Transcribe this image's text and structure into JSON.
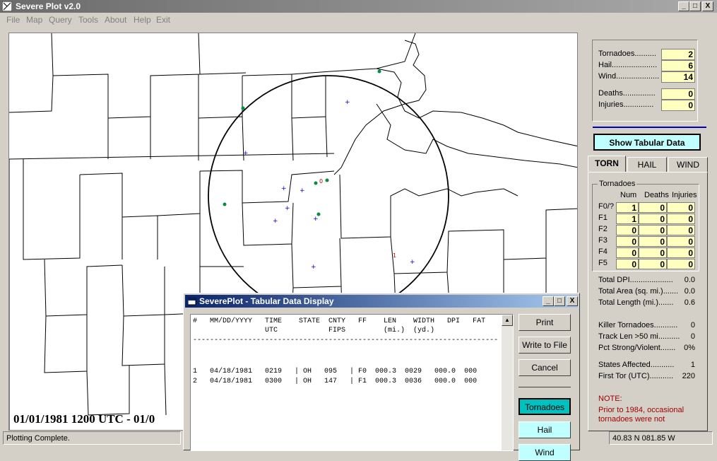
{
  "window": {
    "title": "Severe Plot v2.0",
    "min": "_",
    "max": "□",
    "close": "X"
  },
  "menu": [
    "File",
    "Map",
    "Query",
    "Tools",
    "About",
    "Help",
    "Exit"
  ],
  "map": {
    "date_text": "01/01/1981 1200 UTC - 01/0",
    "labels": [
      "0",
      "1"
    ]
  },
  "status": {
    "left": "Plotting Complete.",
    "coords": "40.83 N  081.85 W",
    "mid": ""
  },
  "summary": {
    "rows": [
      {
        "label": "Tornadoes..........",
        "value": "2"
      },
      {
        "label": "Hail.....................",
        "value": "6"
      },
      {
        "label": "Wind....................",
        "value": "14"
      },
      {
        "label": "Deaths...............",
        "value": "0"
      },
      {
        "label": "Injuries..............",
        "value": "0"
      }
    ]
  },
  "show_tabular": "Show Tabular Data",
  "tabs": [
    "TORN",
    "HAIL",
    "WIND"
  ],
  "torn": {
    "group": "Tornadoes",
    "headers": [
      "Num",
      "Deaths",
      "Injuries"
    ],
    "rows": [
      {
        "label": "F0/?",
        "num": "1",
        "deaths": "0",
        "inj": "0"
      },
      {
        "label": "F1",
        "num": "1",
        "deaths": "0",
        "inj": "0"
      },
      {
        "label": "F2",
        "num": "0",
        "deaths": "0",
        "inj": "0"
      },
      {
        "label": "F3",
        "num": "0",
        "deaths": "0",
        "inj": "0"
      },
      {
        "label": "F4",
        "num": "0",
        "deaths": "0",
        "inj": "0"
      },
      {
        "label": "F5",
        "num": "0",
        "deaths": "0",
        "inj": "0"
      }
    ],
    "stats": [
      {
        "label": "Total DPI....................",
        "value": "0.0"
      },
      {
        "label": "Total Area (sq. mi.).......",
        "value": "0.0"
      },
      {
        "label": "Total Length (mi.).......",
        "value": "0.6"
      },
      {
        "label": "Killer Tornadoes...........",
        "value": "0"
      },
      {
        "label": "Track Len >50 mi..........",
        "value": "0"
      },
      {
        "label": "Pct Strong/Violent.......",
        "value": "0%"
      },
      {
        "label": "States Affected...........",
        "value": "1"
      },
      {
        "label": "First Tor (UTC)...........",
        "value": "220"
      }
    ],
    "note_title": "NOTE:",
    "note_lines": [
      "Prior to 1984, occasional",
      "tornadoes were not"
    ]
  },
  "dialog": {
    "title": "SeverePlot - Tabular Data Display",
    "header1": "#   MM/DD/YYYY   TIME    STATE  CNTY   FF    LEN    WIDTH   DPI   FAT",
    "header2": "                 UTC            FIPS         (mi.)  (yd.)",
    "rule": "------------------------------------------------------------------------------",
    "rows": [
      "1   04/18/1981   0219   | OH   095   | F0  000.3  0029   000.0  000",
      "2   04/18/1981   0300   | OH   147   | F1  000.3  0036   000.0  000"
    ],
    "buttons": [
      "Print",
      "Write to File",
      "Cancel"
    ],
    "type_buttons": [
      "Tornadoes",
      "Hail",
      "Wind"
    ]
  },
  "colors": {
    "tornadoes_btn": "#00c0c0",
    "hail_btn": "#c0ffff",
    "summary_cell": "#ffffc0",
    "note": "#a00000"
  }
}
